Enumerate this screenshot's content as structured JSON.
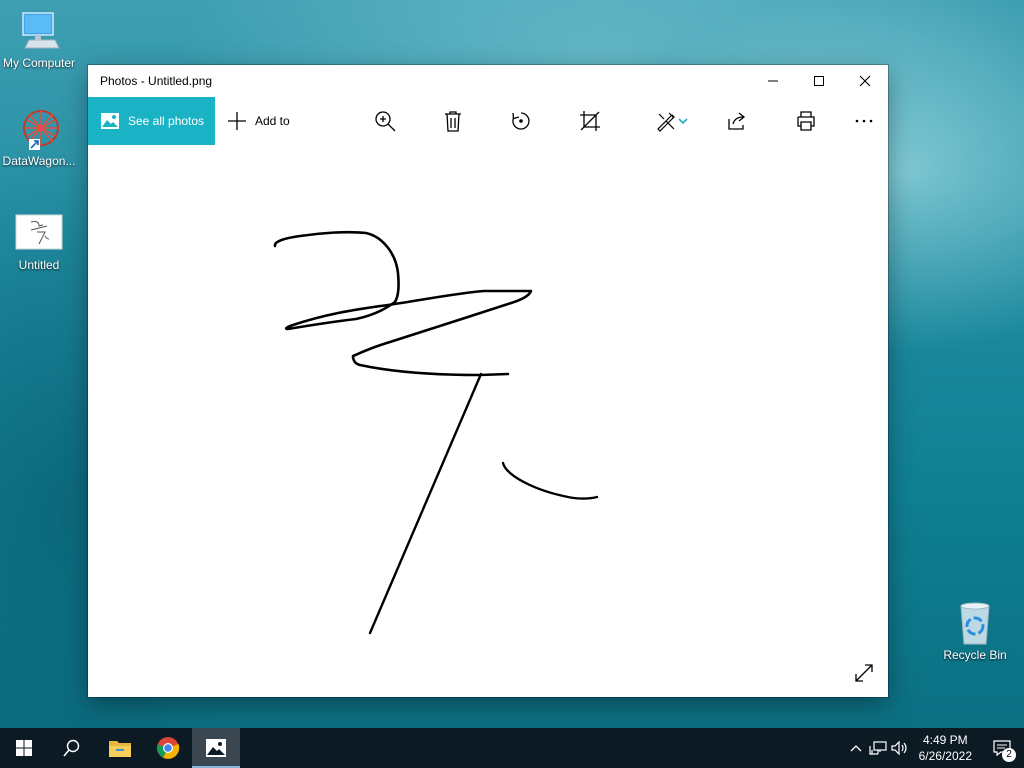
{
  "desktop": {
    "icons": [
      {
        "label": "My Computer"
      },
      {
        "label": "DataWagon..."
      },
      {
        "label": "Untitled"
      },
      {
        "label": "Recycle Bin"
      }
    ]
  },
  "window": {
    "title": "Photos - Untitled.png",
    "toolbar": {
      "see_all_photos": "See all photos",
      "add_to": "Add to"
    }
  },
  "taskbar": {
    "time": "4:49 PM",
    "date": "6/26/2022",
    "notification_count": "2"
  },
  "colors": {
    "accent": "#1ab3c6",
    "taskbar": "#0c1a24"
  }
}
